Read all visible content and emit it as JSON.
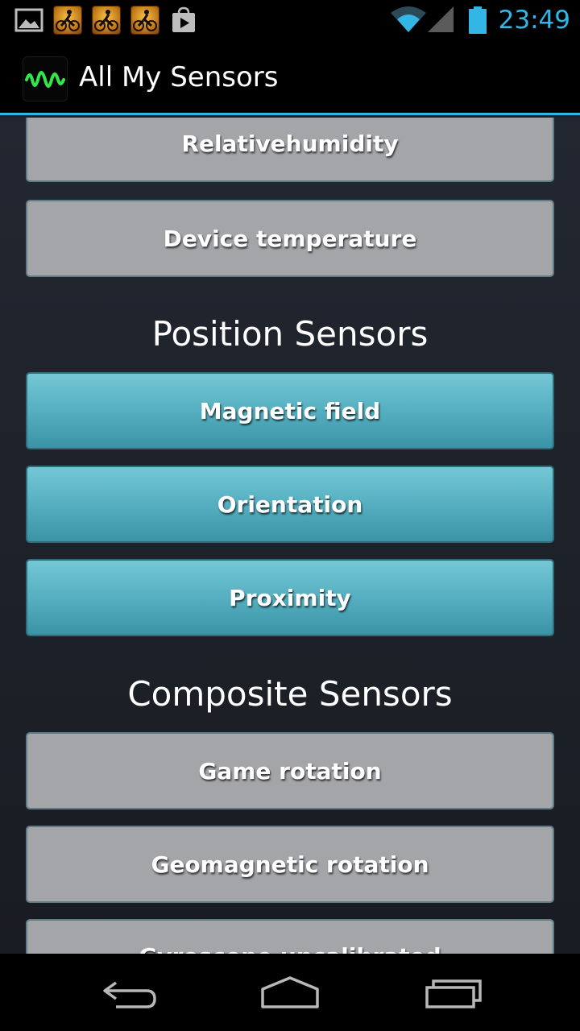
{
  "status_bar": {
    "time": "23:49",
    "notification_icons": [
      "image-icon",
      "game-icon",
      "game-icon",
      "game-icon",
      "play-store-icon"
    ],
    "status_icons": [
      "wifi-icon",
      "cell-signal-icon",
      "battery-icon"
    ],
    "accent_color": "#33b5e5"
  },
  "action_bar": {
    "title": "All My Sensors",
    "icon": "waveform-icon"
  },
  "environment_buttons": [
    {
      "label": "Relativehumidity"
    },
    {
      "label": "Device temperature"
    }
  ],
  "position_section": {
    "title": "Position Sensors",
    "buttons": [
      {
        "label": "Magnetic field"
      },
      {
        "label": "Orientation"
      },
      {
        "label": "Proximity"
      }
    ]
  },
  "composite_section": {
    "title": "Composite Sensors",
    "buttons": [
      {
        "label": "Game rotation"
      },
      {
        "label": "Geomagnetic rotation"
      },
      {
        "label": "Gyroscope uncalibrated"
      }
    ]
  },
  "nav_bar": {
    "buttons": [
      "back-icon",
      "home-icon",
      "recent-apps-icon"
    ]
  }
}
